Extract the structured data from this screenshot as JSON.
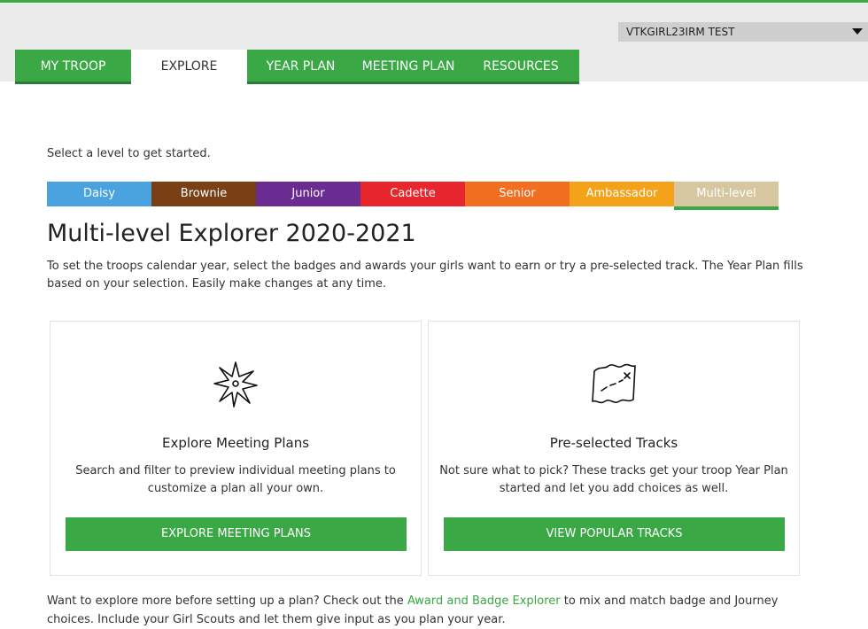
{
  "user_menu": {
    "label": "VTKGIRL23IRM TEST"
  },
  "nav": {
    "tabs": [
      {
        "label": "MY TROOP"
      },
      {
        "label": "EXPLORE"
      },
      {
        "label": "YEAR PLAN"
      },
      {
        "label": "MEETING PLAN"
      },
      {
        "label": "RESOURCES"
      }
    ],
    "active_tab": "EXPLORE"
  },
  "prompt": "Select a level to get started.",
  "levels": [
    {
      "label": "Daisy",
      "color": "#4aa3df"
    },
    {
      "label": "Brownie",
      "color": "#7b3f16"
    },
    {
      "label": "Junior",
      "color": "#6b2c91"
    },
    {
      "label": "Cadette",
      "color": "#e8262e"
    },
    {
      "label": "Senior",
      "color": "#f26f21"
    },
    {
      "label": "Ambassador",
      "color": "#f5a21b"
    },
    {
      "label": "Multi-level",
      "color": "#d6c7a1"
    }
  ],
  "active_level": "Multi-level",
  "page_title": "Multi-level Explorer 2020-2021",
  "intro": "To set the troops calendar year, select the badges and awards your girls want to earn or try a pre-selected track. The Year Plan fills based on your selection. Easily make changes at any time.",
  "cards": [
    {
      "icon": "compass-star-icon",
      "title": "Explore Meeting Plans",
      "description": "Search and filter to preview individual meeting plans to customize a plan all your own.",
      "button": "EXPLORE MEETING PLANS"
    },
    {
      "icon": "treasure-map-icon",
      "title": "Pre-selected Tracks",
      "description": "Not sure what to pick? These tracks get your troop Year Plan started and let you add choices as well.",
      "button": "VIEW POPULAR TRACKS"
    }
  ],
  "footer": {
    "before": "Want to explore more before setting up a plan? Check out the ",
    "link": "Award and Badge Explorer",
    "after": " to mix and match badge and Journey choices. Include your Girl Scouts and let them give input as you plan your year."
  },
  "colors": {
    "accent": "#39a845",
    "nav_underline": "#2a7d34"
  }
}
